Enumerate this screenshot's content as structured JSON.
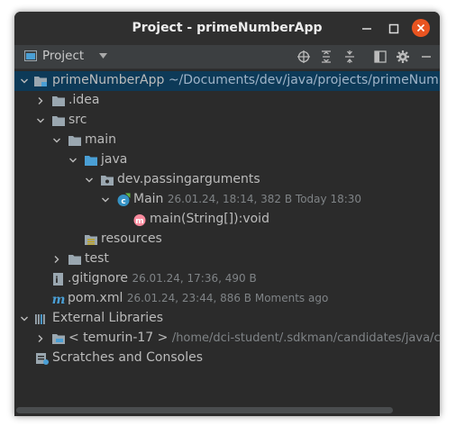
{
  "window": {
    "title": "Project - primeNumberApp"
  },
  "toolbar": {
    "view_label": "Project"
  },
  "tree": {
    "root": {
      "name": "primeNumberApp",
      "path": "~/Documents/dev/java/projects/primeNum"
    },
    "idea": "idea",
    "idea_prefix": ".",
    "src": "src",
    "main": "main",
    "java": "java",
    "package": "dev.passingarguments",
    "main_class": {
      "name": "Main",
      "meta": "26.01.24, 18:14, 382 B Today 18:30"
    },
    "main_method": "main(String[]):void",
    "resources": "resources",
    "test": "test",
    "gitignore": {
      "name": ".gitignore",
      "meta": "26.01.24, 17:36, 490 B"
    },
    "pom": {
      "name": "pom.xml",
      "meta": "26.01.24, 23:44, 886 B Moments ago"
    },
    "external_libraries": "External Libraries",
    "jdk": {
      "name": "< temurin-17 >",
      "path": "/home/dci-student/.sdkman/candidates/java/c"
    },
    "scratches": "Scratches and Consoles"
  },
  "colors": {
    "selection": "#0d3a58",
    "folder": "#9aa7b0",
    "source_folder": "#4a9fd5",
    "close_button": "#e95420"
  }
}
